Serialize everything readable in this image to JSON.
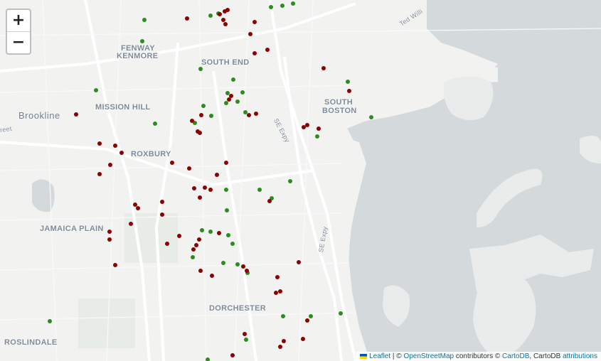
{
  "zoom": {
    "in_label": "+",
    "out_label": "−"
  },
  "labels": {
    "fenway": "FENWAY",
    "kenmore": "KENMORE",
    "south_end": "SOUTH END",
    "mission_hill": "MISSION HILL",
    "brookline": "Brookline",
    "south_boston_1": "SOUTH",
    "south_boston_2": "BOSTON",
    "roxbury": "ROXBURY",
    "jamaica_plain": "JAMAICA PLAIN",
    "dorchester": "DORCHESTER",
    "roslindale": "ROSLINDALE",
    "se_expy_1": "SE Expy",
    "se_expy_2": "SE Expy",
    "ted_williams": "Ted Willi",
    "street_frag": "reet"
  },
  "attribution": {
    "leaflet": "Leaflet",
    "sep": " | © ",
    "osm": "OpenStreetMap",
    "contributors": " contributors © ",
    "carto": "CartoDB",
    "carto2": ", CartoDB ",
    "attributions": "attributions"
  },
  "colors": {
    "green": "#2e8b22",
    "red": "#8b0000",
    "water": "#d4dadc",
    "land": "#f2f2f0"
  }
}
